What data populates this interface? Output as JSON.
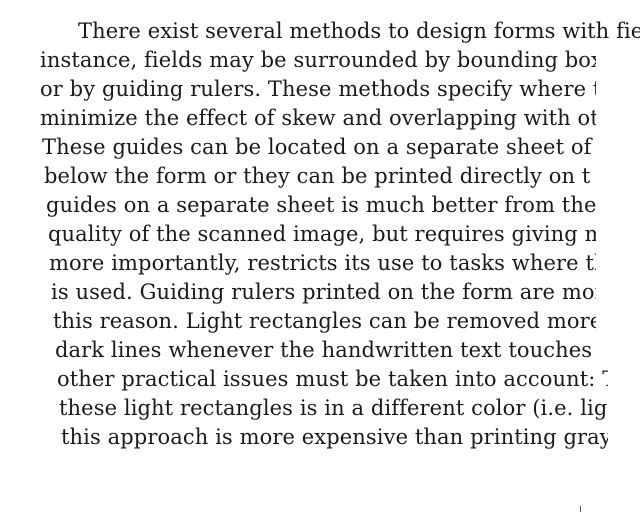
{
  "document": {
    "lines": [
      "There exist several methods to design forms with fie",
      "instance, fields may be surrounded by bounding boxe",
      "or by guiding rulers. These methods specify where to",
      "minimize the effect of skew and overlapping with oth",
      "These guides can be located on a separate sheet of",
      "below the form or they can be printed directly on t",
      "guides on a separate sheet is much better from the",
      "quality of the scanned image, but requires giving m",
      "more importantly, restricts its use to tasks where th",
      "is used. Guiding rulers printed on the form are mor",
      "this reason. Light rectangles can be removed more e",
      "dark lines whenever the handwritten text touches the",
      "other practical issues must be taken into account: T",
      "these light rectangles is in a different color (i.e. lig",
      "this approach is more expensive than printing gray r"
    ]
  }
}
